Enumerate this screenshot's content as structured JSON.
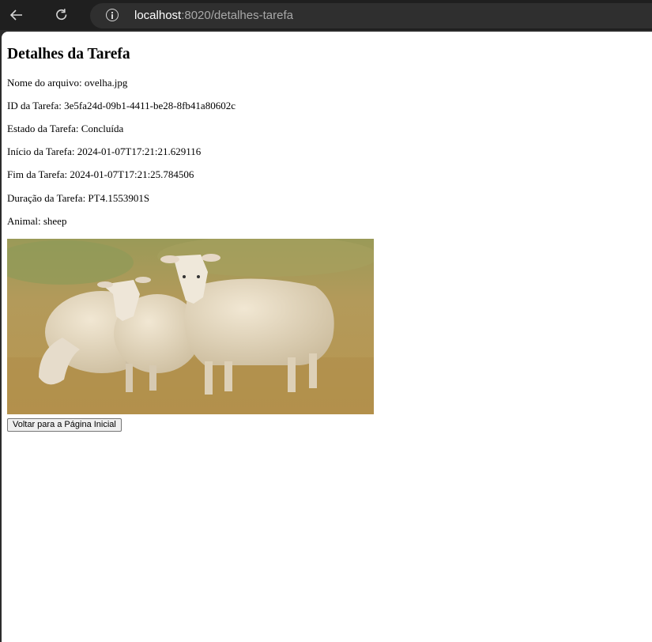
{
  "browser": {
    "url_host": "localhost",
    "url_rest": ":8020/detalhes-tarefa",
    "icons": {
      "back": "back-arrow-icon",
      "reload": "reload-icon",
      "info": "info-icon"
    }
  },
  "page": {
    "title": "Detalhes da Tarefa",
    "lines": [
      "Nome do arquivo: ovelha.jpg",
      "ID da Tarefa: 3e5fa24d-09b1-4411-be28-8fb41a80602c",
      "Estado da Tarefa: Concluída",
      "Início da Tarefa: 2024-01-07T17:21:21.629116",
      "Fim da Tarefa: 2024-01-07T17:21:25.784506",
      "Duração da Tarefa: PT4.1553901S",
      "Animal: sheep"
    ],
    "back_button": "Voltar para a Página Inicial"
  }
}
